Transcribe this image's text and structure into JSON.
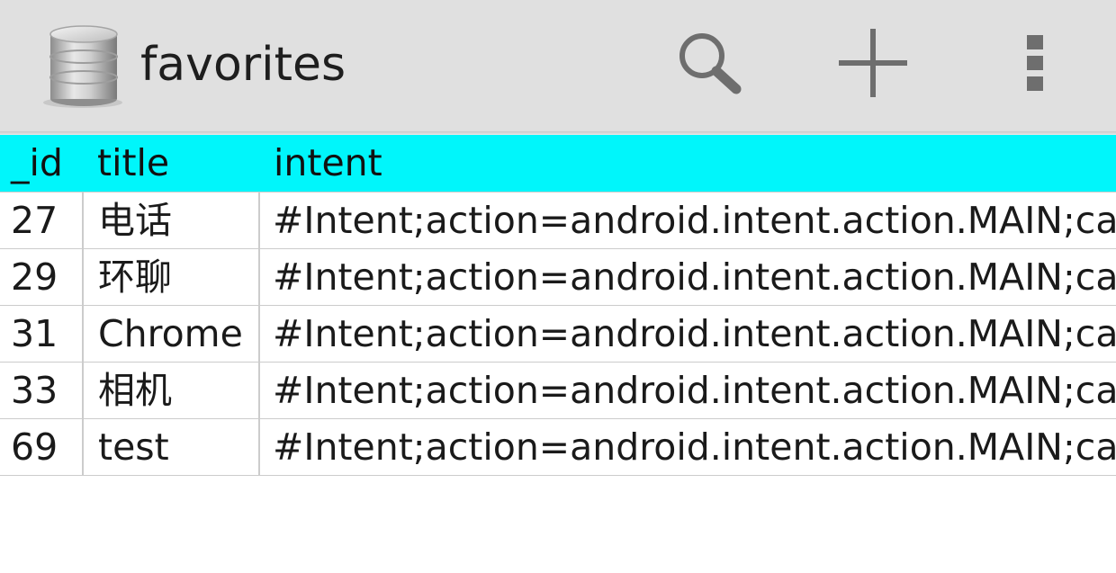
{
  "toolbar": {
    "title": "favorites",
    "app_icon": "database-icon",
    "actions": [
      {
        "name": "search",
        "icon": "search-icon"
      },
      {
        "name": "add",
        "icon": "plus-icon"
      },
      {
        "name": "more",
        "icon": "overflow-menu-icon"
      }
    ]
  },
  "colors": {
    "toolbar_bg": "#e0e0e0",
    "header_bg": "#00f6fb",
    "icon_gray": "#6e6e6e"
  },
  "table": {
    "columns": [
      "_id",
      "title",
      "intent"
    ],
    "rows": [
      {
        "id": "27",
        "title": "电话",
        "intent": "#Intent;action=android.intent.action.MAIN;cate"
      },
      {
        "id": "29",
        "title": "环聊",
        "intent": "#Intent;action=android.intent.action.MAIN;cate"
      },
      {
        "id": "31",
        "title": "Chrome",
        "intent": "#Intent;action=android.intent.action.MAIN;cate"
      },
      {
        "id": "33",
        "title": "相机",
        "intent": "#Intent;action=android.intent.action.MAIN;cate"
      },
      {
        "id": "69",
        "title": "test",
        "intent": "#Intent;action=android.intent.action.MAIN;cate"
      }
    ]
  }
}
